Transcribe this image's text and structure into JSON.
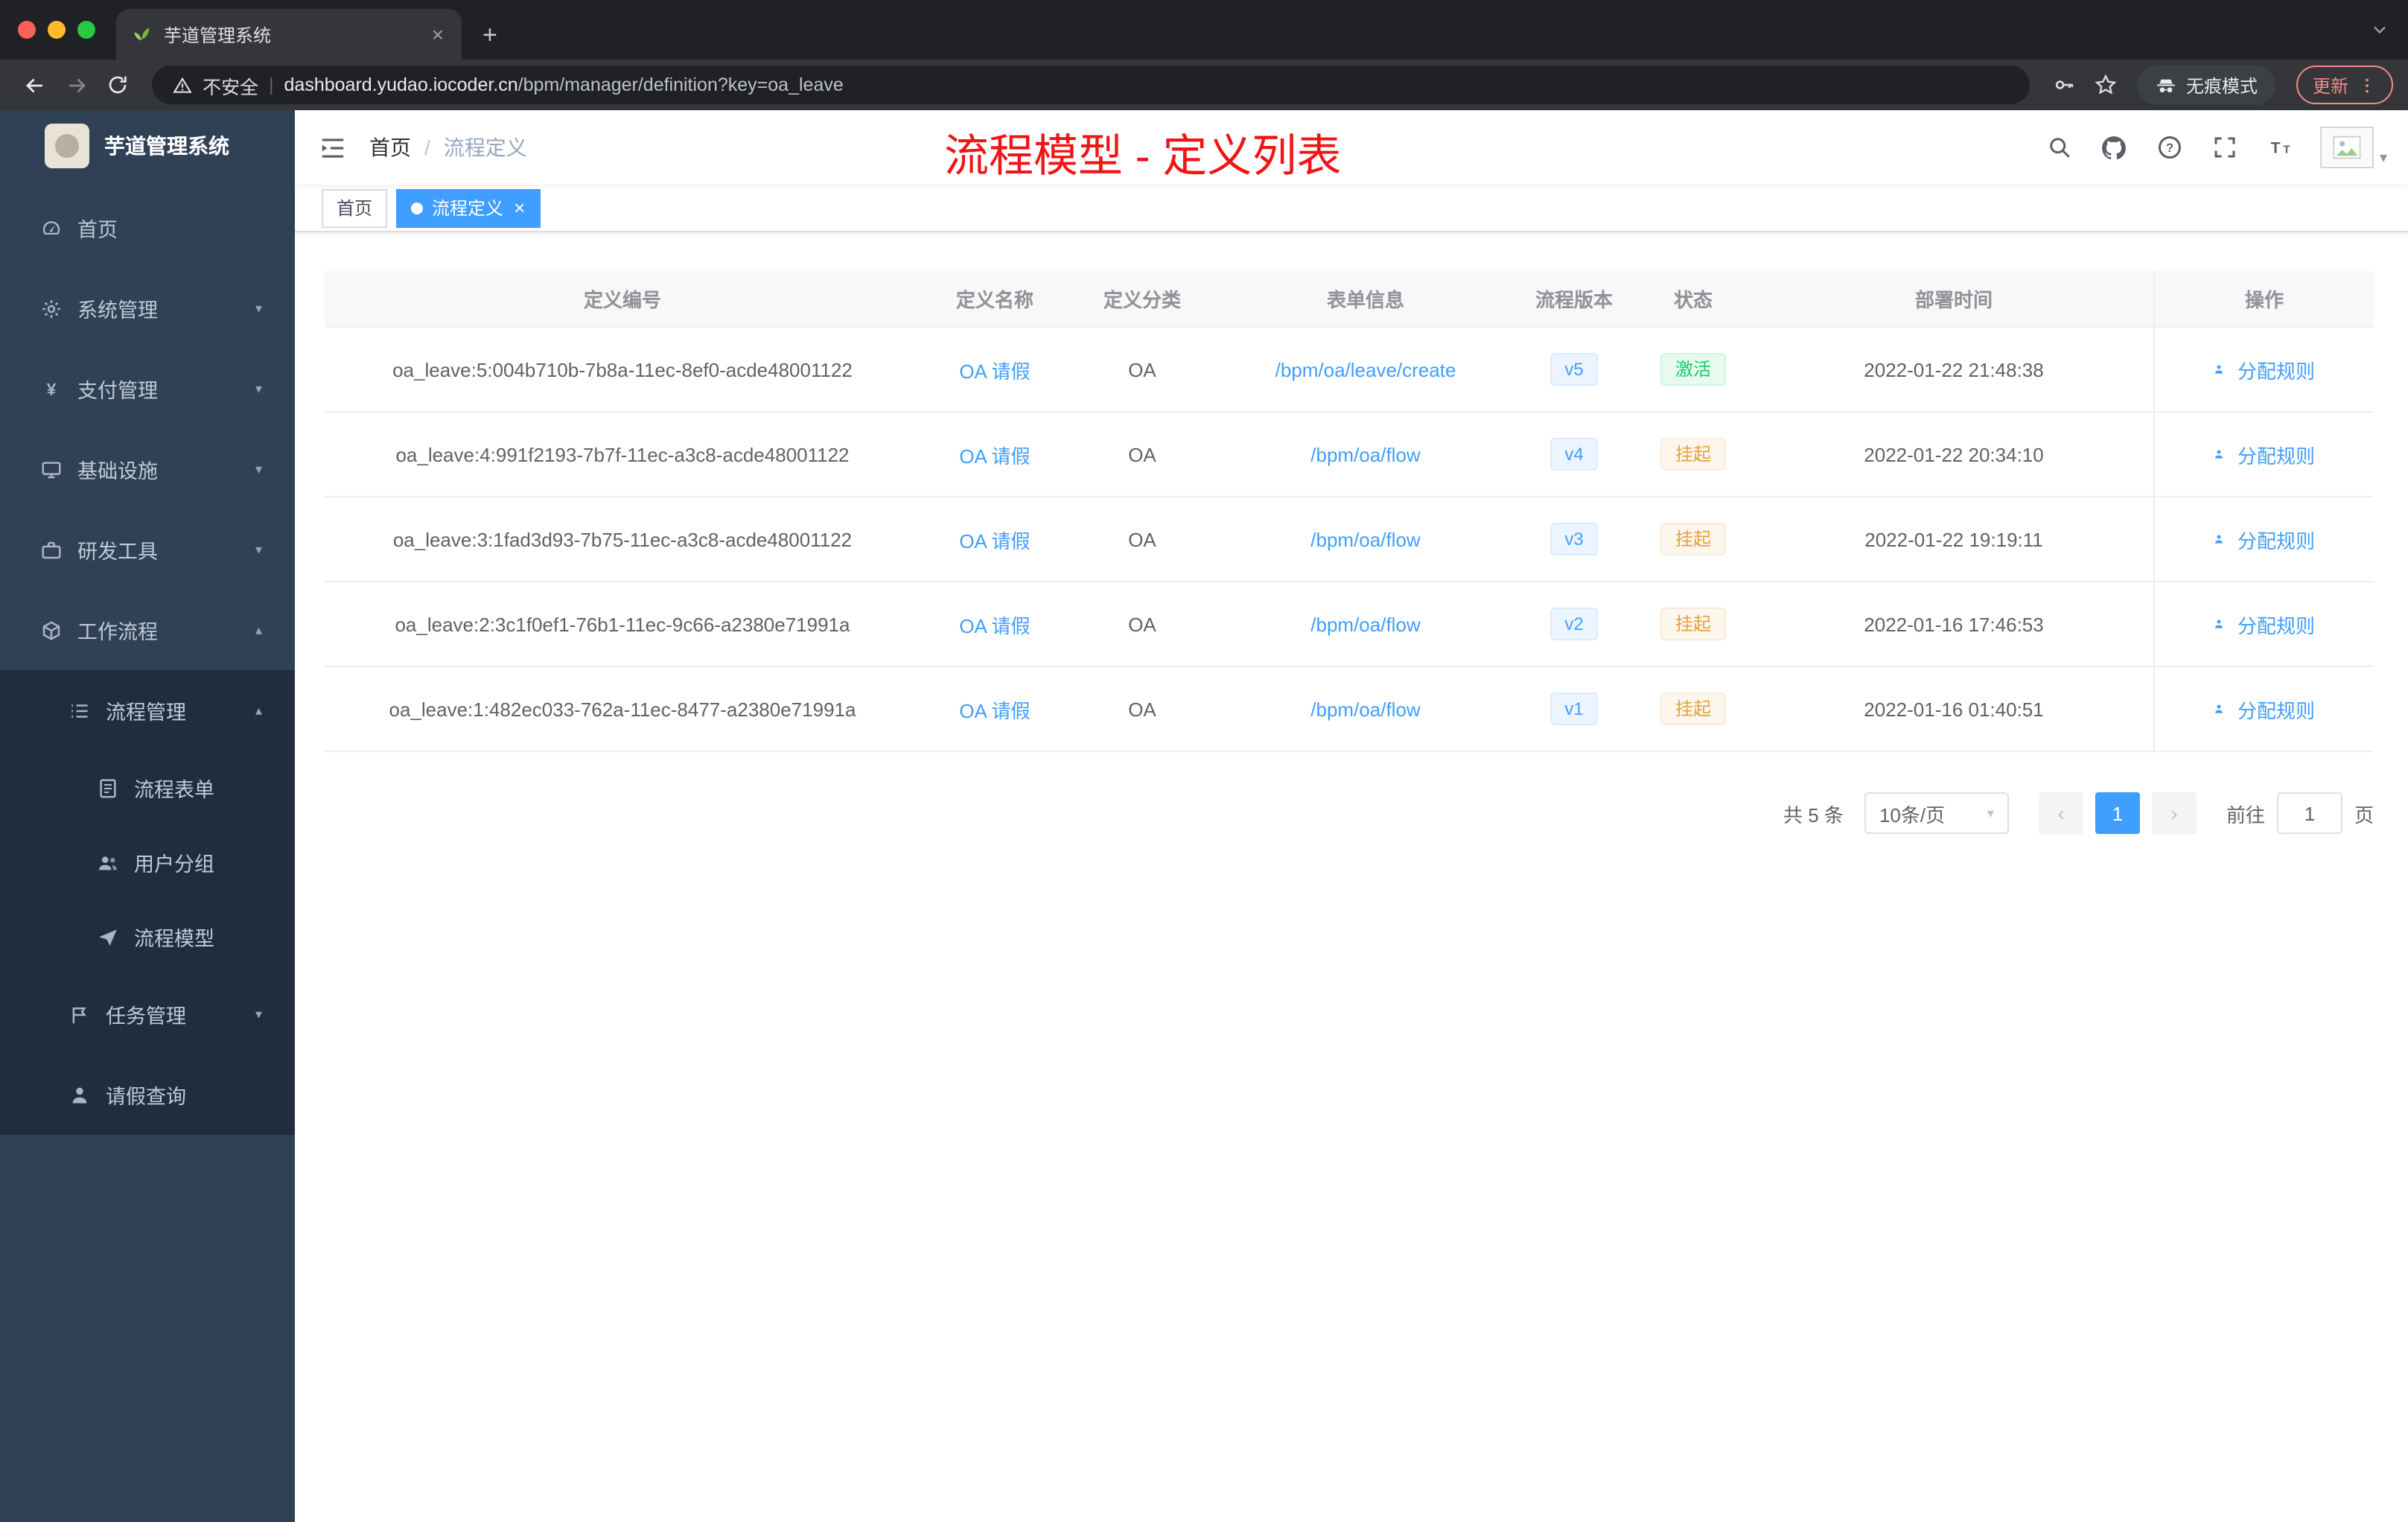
{
  "colors": {
    "accent": "#409eff",
    "success": "#13ce66",
    "warning": "#e6a23c",
    "annotation_red": "#f01414",
    "sidebar_bg": "#304156",
    "submenu_bg": "#1f2d3d"
  },
  "browser": {
    "tab_title": "芋道管理系统",
    "security_label": "不安全",
    "url_host": "dashboard.yudao.iocoder.cn",
    "url_path": "/bpm/manager/definition?key=oa_leave",
    "incognito_label": "无痕模式",
    "update_label": "更新"
  },
  "sidebar": {
    "logo_title": "芋道管理系统",
    "items": [
      {
        "key": "home",
        "label": "首页",
        "icon": "dashboard",
        "level": 1,
        "expandable": false,
        "expanded": false
      },
      {
        "key": "system",
        "label": "系统管理",
        "icon": "setting",
        "level": 1,
        "expandable": true,
        "expanded": false
      },
      {
        "key": "payment",
        "label": "支付管理",
        "icon": "payment",
        "level": 1,
        "expandable": true,
        "expanded": false
      },
      {
        "key": "infra",
        "label": "基础设施",
        "icon": "infra",
        "level": 1,
        "expandable": true,
        "expanded": false
      },
      {
        "key": "devtool",
        "label": "研发工具",
        "icon": "devtool",
        "level": 1,
        "expandable": true,
        "expanded": false
      },
      {
        "key": "workflow",
        "label": "工作流程",
        "icon": "workflow",
        "level": 1,
        "expandable": true,
        "expanded": true
      },
      {
        "key": "process-manage",
        "label": "流程管理",
        "icon": "process",
        "level": 2,
        "expandable": true,
        "expanded": true
      },
      {
        "key": "process-form",
        "label": "流程表单",
        "icon": "form",
        "level": 3,
        "expandable": false,
        "expanded": false
      },
      {
        "key": "user-group",
        "label": "用户分组",
        "icon": "group",
        "level": 3,
        "expandable": false,
        "expanded": false
      },
      {
        "key": "process-model",
        "label": "流程模型",
        "icon": "model",
        "level": 3,
        "expandable": false,
        "expanded": false
      },
      {
        "key": "task-manage",
        "label": "任务管理",
        "icon": "task",
        "level": 2,
        "expandable": true,
        "expanded": false
      },
      {
        "key": "leave-query",
        "label": "请假查询",
        "icon": "leave",
        "level": 2,
        "expandable": false,
        "expanded": false
      }
    ]
  },
  "header": {
    "breadcrumb_home": "首页",
    "breadcrumb_sep": "/",
    "breadcrumb_current": "流程定义",
    "annotation": "流程模型 - 定义列表"
  },
  "tags": [
    {
      "key": "home",
      "label": "首页",
      "active": false,
      "closable": false
    },
    {
      "key": "process-definition",
      "label": "流程定义",
      "active": true,
      "closable": true
    }
  ],
  "table": {
    "columns": [
      "定义编号",
      "定义名称",
      "定义分类",
      "表单信息",
      "流程版本",
      "状态",
      "部署时间",
      "操作"
    ],
    "rows": [
      {
        "id": "oa_leave:5:004b710b-7b8a-11ec-8ef0-acde48001122",
        "name": "OA 请假",
        "category": "OA",
        "form": "/bpm/oa/leave/create",
        "version": "v5",
        "status": "激活",
        "status_type": "success",
        "time": "2022-01-22 21:48:38",
        "action": "分配规则"
      },
      {
        "id": "oa_leave:4:991f2193-7b7f-11ec-a3c8-acde48001122",
        "name": "OA 请假",
        "category": "OA",
        "form": "/bpm/oa/flow",
        "version": "v4",
        "status": "挂起",
        "status_type": "warning",
        "time": "2022-01-22 20:34:10",
        "action": "分配规则"
      },
      {
        "id": "oa_leave:3:1fad3d93-7b75-11ec-a3c8-acde48001122",
        "name": "OA 请假",
        "category": "OA",
        "form": "/bpm/oa/flow",
        "version": "v3",
        "status": "挂起",
        "status_type": "warning",
        "time": "2022-01-22 19:19:11",
        "action": "分配规则"
      },
      {
        "id": "oa_leave:2:3c1f0ef1-76b1-11ec-9c66-a2380e71991a",
        "name": "OA 请假",
        "category": "OA",
        "form": "/bpm/oa/flow",
        "version": "v2",
        "status": "挂起",
        "status_type": "warning",
        "time": "2022-01-16 17:46:53",
        "action": "分配规则"
      },
      {
        "id": "oa_leave:1:482ec033-762a-11ec-8477-a2380e71991a",
        "name": "OA 请假",
        "category": "OA",
        "form": "/bpm/oa/flow",
        "version": "v1",
        "status": "挂起",
        "status_type": "warning",
        "time": "2022-01-16 01:40:51",
        "action": "分配规则"
      }
    ]
  },
  "pagination": {
    "total_label": "共 5 条",
    "page_size_label": "10条/页",
    "current_page": "1",
    "goto_label": "前往",
    "goto_value": "1",
    "unit_label": "页"
  }
}
